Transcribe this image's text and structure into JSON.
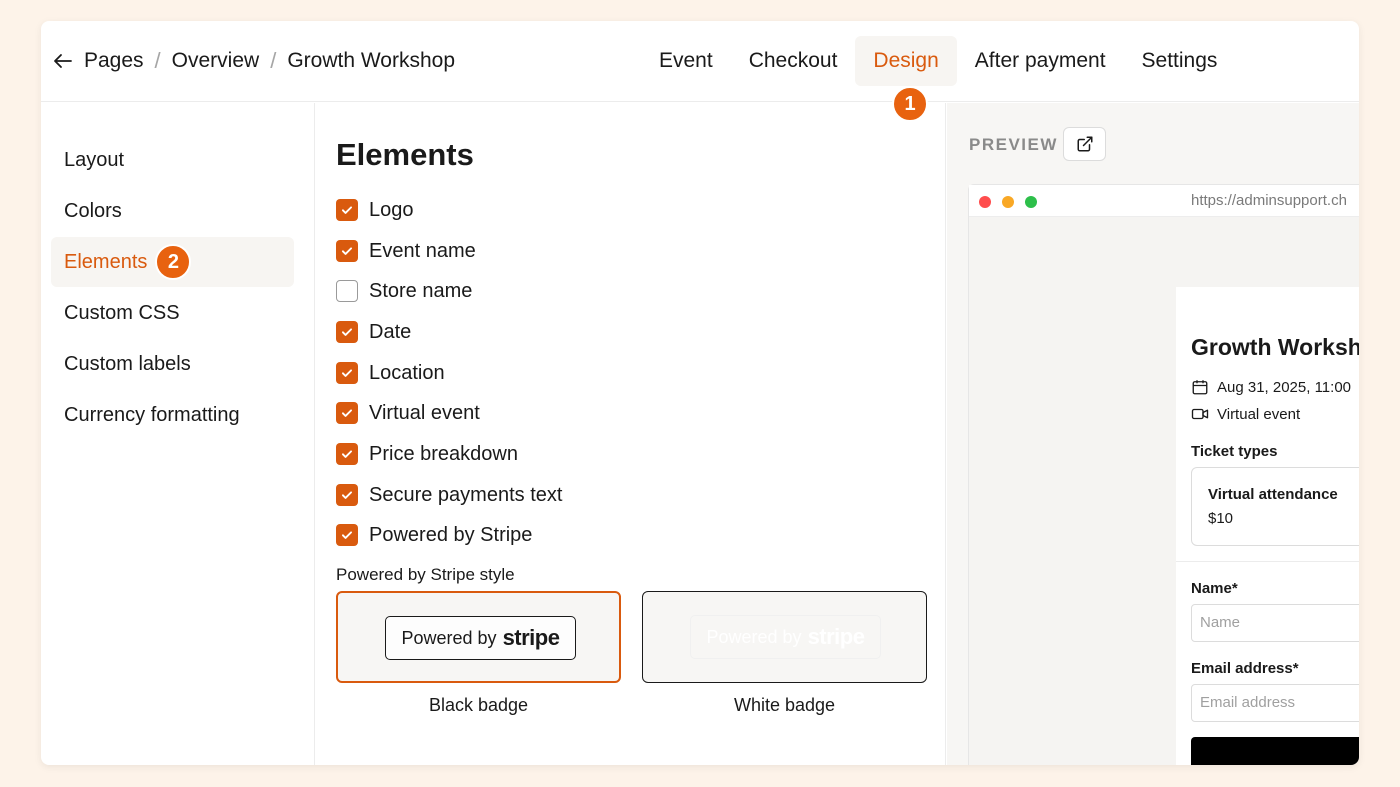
{
  "header": {
    "breadcrumb": [
      "Pages",
      "Overview",
      "Growth Workshop"
    ],
    "tabs": [
      "Event",
      "Checkout",
      "Design",
      "After payment",
      "Settings"
    ],
    "active_tab": "Design",
    "step_one": "1"
  },
  "sidebar": {
    "items": [
      "Layout",
      "Colors",
      "Elements",
      "Custom CSS",
      "Custom labels",
      "Currency formatting"
    ],
    "active": "Elements",
    "step_two": "2"
  },
  "elements": {
    "title": "Elements",
    "checks": [
      {
        "label": "Logo",
        "checked": true
      },
      {
        "label": "Event name",
        "checked": true
      },
      {
        "label": "Store name",
        "checked": false
      },
      {
        "label": "Date",
        "checked": true
      },
      {
        "label": "Location",
        "checked": true
      },
      {
        "label": "Virtual event",
        "checked": true
      },
      {
        "label": "Price breakdown",
        "checked": true
      },
      {
        "label": "Secure payments text",
        "checked": true
      },
      {
        "label": "Powered by Stripe",
        "checked": true
      }
    ],
    "style_label": "Powered by Stripe style",
    "badge_prefix": "Powered by",
    "badge_brand": "stripe",
    "options": [
      {
        "caption": "Black badge",
        "selected": true
      },
      {
        "caption": "White badge",
        "selected": false
      }
    ]
  },
  "preview": {
    "label": "PREVIEW",
    "url": "https://adminsupport.ch",
    "event_title": "Growth Workshop",
    "date": "Aug 31, 2025, 11:00",
    "location": "Virtual event",
    "ticket_types_label": "Ticket types",
    "ticket_name": "Virtual attendance",
    "ticket_price": "$10",
    "name_label": "Name",
    "name_placeholder": "Name",
    "email_label": "Email address",
    "email_placeholder": "Email address",
    "required_mark": "*"
  },
  "colors": {
    "accent": "#d95a0e",
    "badge": "#e8620f",
    "background": "#fdf3e9"
  },
  "icons": [
    "back-arrow-icon",
    "external-link-icon",
    "calendar-icon",
    "video-icon",
    "check-icon"
  ]
}
